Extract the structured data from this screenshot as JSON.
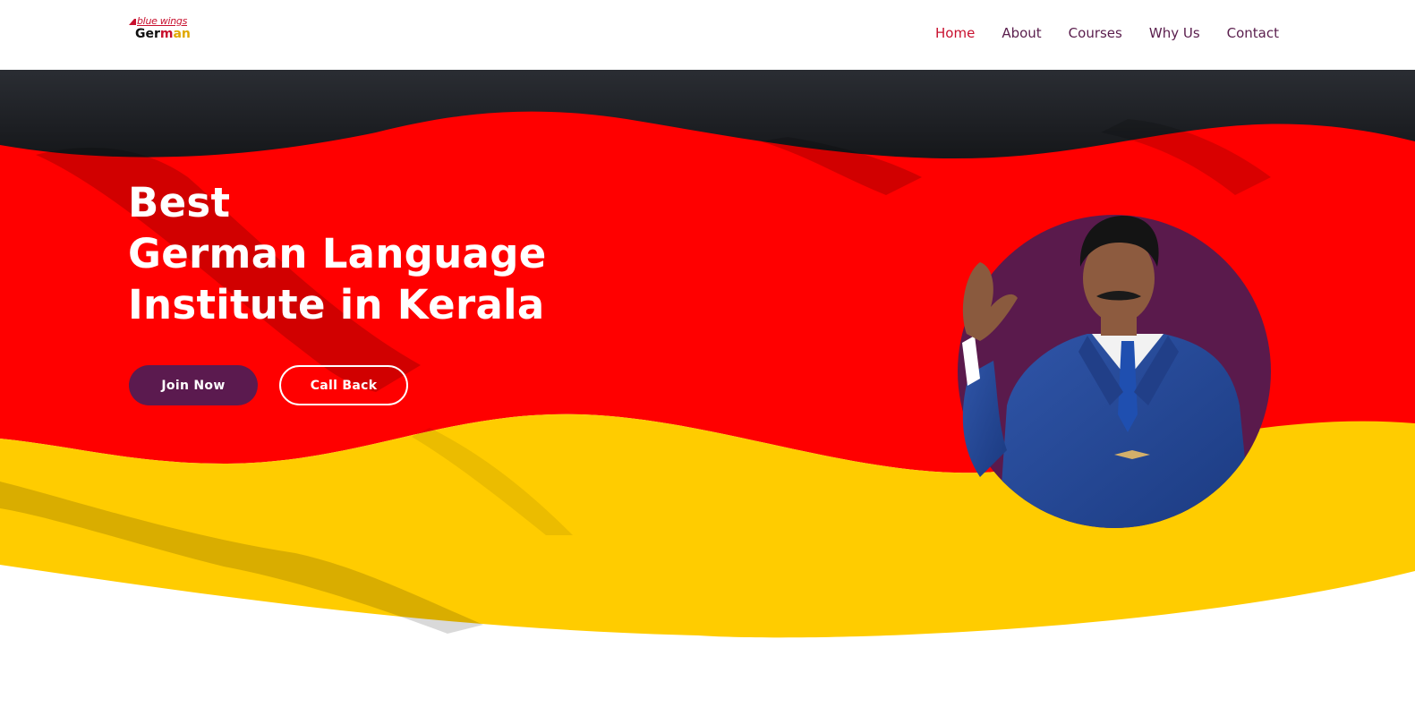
{
  "brand": {
    "logo_top": "blue wings",
    "logo_bottom": [
      "Ger",
      "m",
      "an"
    ]
  },
  "nav": {
    "items": [
      {
        "label": "Home",
        "active": true
      },
      {
        "label": "About",
        "active": false
      },
      {
        "label": "Courses",
        "active": false
      },
      {
        "label": "Why Us",
        "active": false
      },
      {
        "label": "Contact",
        "active": false
      }
    ]
  },
  "hero": {
    "headline": [
      "Best",
      "German Language",
      "Institute in Kerala"
    ],
    "buttons": {
      "join": "Join Now",
      "call_back": "Call Back"
    }
  },
  "colors": {
    "flag_black": "#000000",
    "flag_red": "#ff0000",
    "flag_gold": "#ffcc00",
    "accent_purple": "#5b1a4f",
    "nav_active": "#c8102e",
    "nav_text": "#5a1e4d"
  }
}
